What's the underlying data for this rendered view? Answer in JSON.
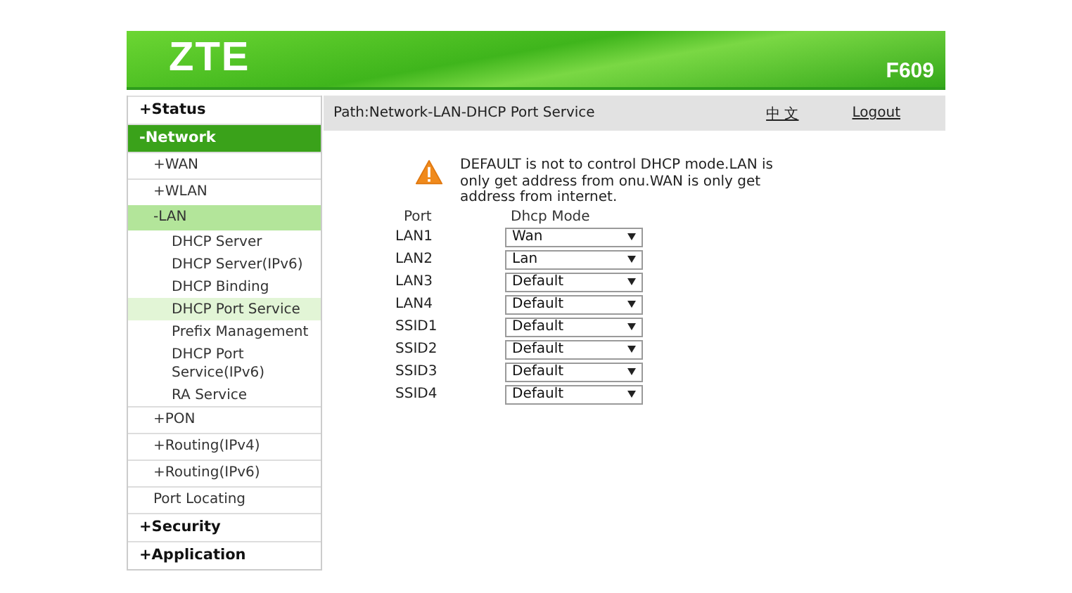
{
  "header": {
    "logo": "ZTE",
    "model": "F609"
  },
  "sidebar": {
    "items": [
      {
        "label": "+Status",
        "selected": false
      },
      {
        "label": "-Network",
        "selected": true,
        "children": [
          {
            "label": "+WAN",
            "selected": false
          },
          {
            "label": "+WLAN",
            "selected": false
          },
          {
            "label": "-LAN",
            "selected": true,
            "children": [
              {
                "label": "DHCP Server",
                "selected": false
              },
              {
                "label": "DHCP Server(IPv6)",
                "selected": false
              },
              {
                "label": "DHCP Binding",
                "selected": false
              },
              {
                "label": "DHCP Port Service",
                "selected": true
              },
              {
                "label": "Prefix Management",
                "selected": false
              },
              {
                "label": "DHCP Port Service(IPv6)",
                "selected": false
              },
              {
                "label": "RA Service",
                "selected": false
              }
            ]
          },
          {
            "label": "+PON",
            "selected": false
          },
          {
            "label": "+Routing(IPv4)",
            "selected": false
          },
          {
            "label": "+Routing(IPv6)",
            "selected": false
          },
          {
            "label": "Port Locating",
            "selected": false
          }
        ]
      },
      {
        "label": "+Security",
        "selected": false
      },
      {
        "label": "+Application",
        "selected": false
      }
    ]
  },
  "path_bar": {
    "path": "Path:Network-LAN-DHCP Port Service",
    "language_link": "中 文",
    "logout_link": "Logout"
  },
  "notice": "DEFAULT is not to control DHCP mode.LAN is only get address from onu.WAN is only get address from internet.",
  "table": {
    "columns": [
      "Port",
      "Dhcp Mode"
    ],
    "rows": [
      {
        "port": "LAN1",
        "mode": "Wan"
      },
      {
        "port": "LAN2",
        "mode": "Lan"
      },
      {
        "port": "LAN3",
        "mode": "Default"
      },
      {
        "port": "LAN4",
        "mode": "Default"
      },
      {
        "port": "SSID1",
        "mode": "Default"
      },
      {
        "port": "SSID2",
        "mode": "Default"
      },
      {
        "port": "SSID3",
        "mode": "Default"
      },
      {
        "port": "SSID4",
        "mode": "Default"
      }
    ]
  }
}
